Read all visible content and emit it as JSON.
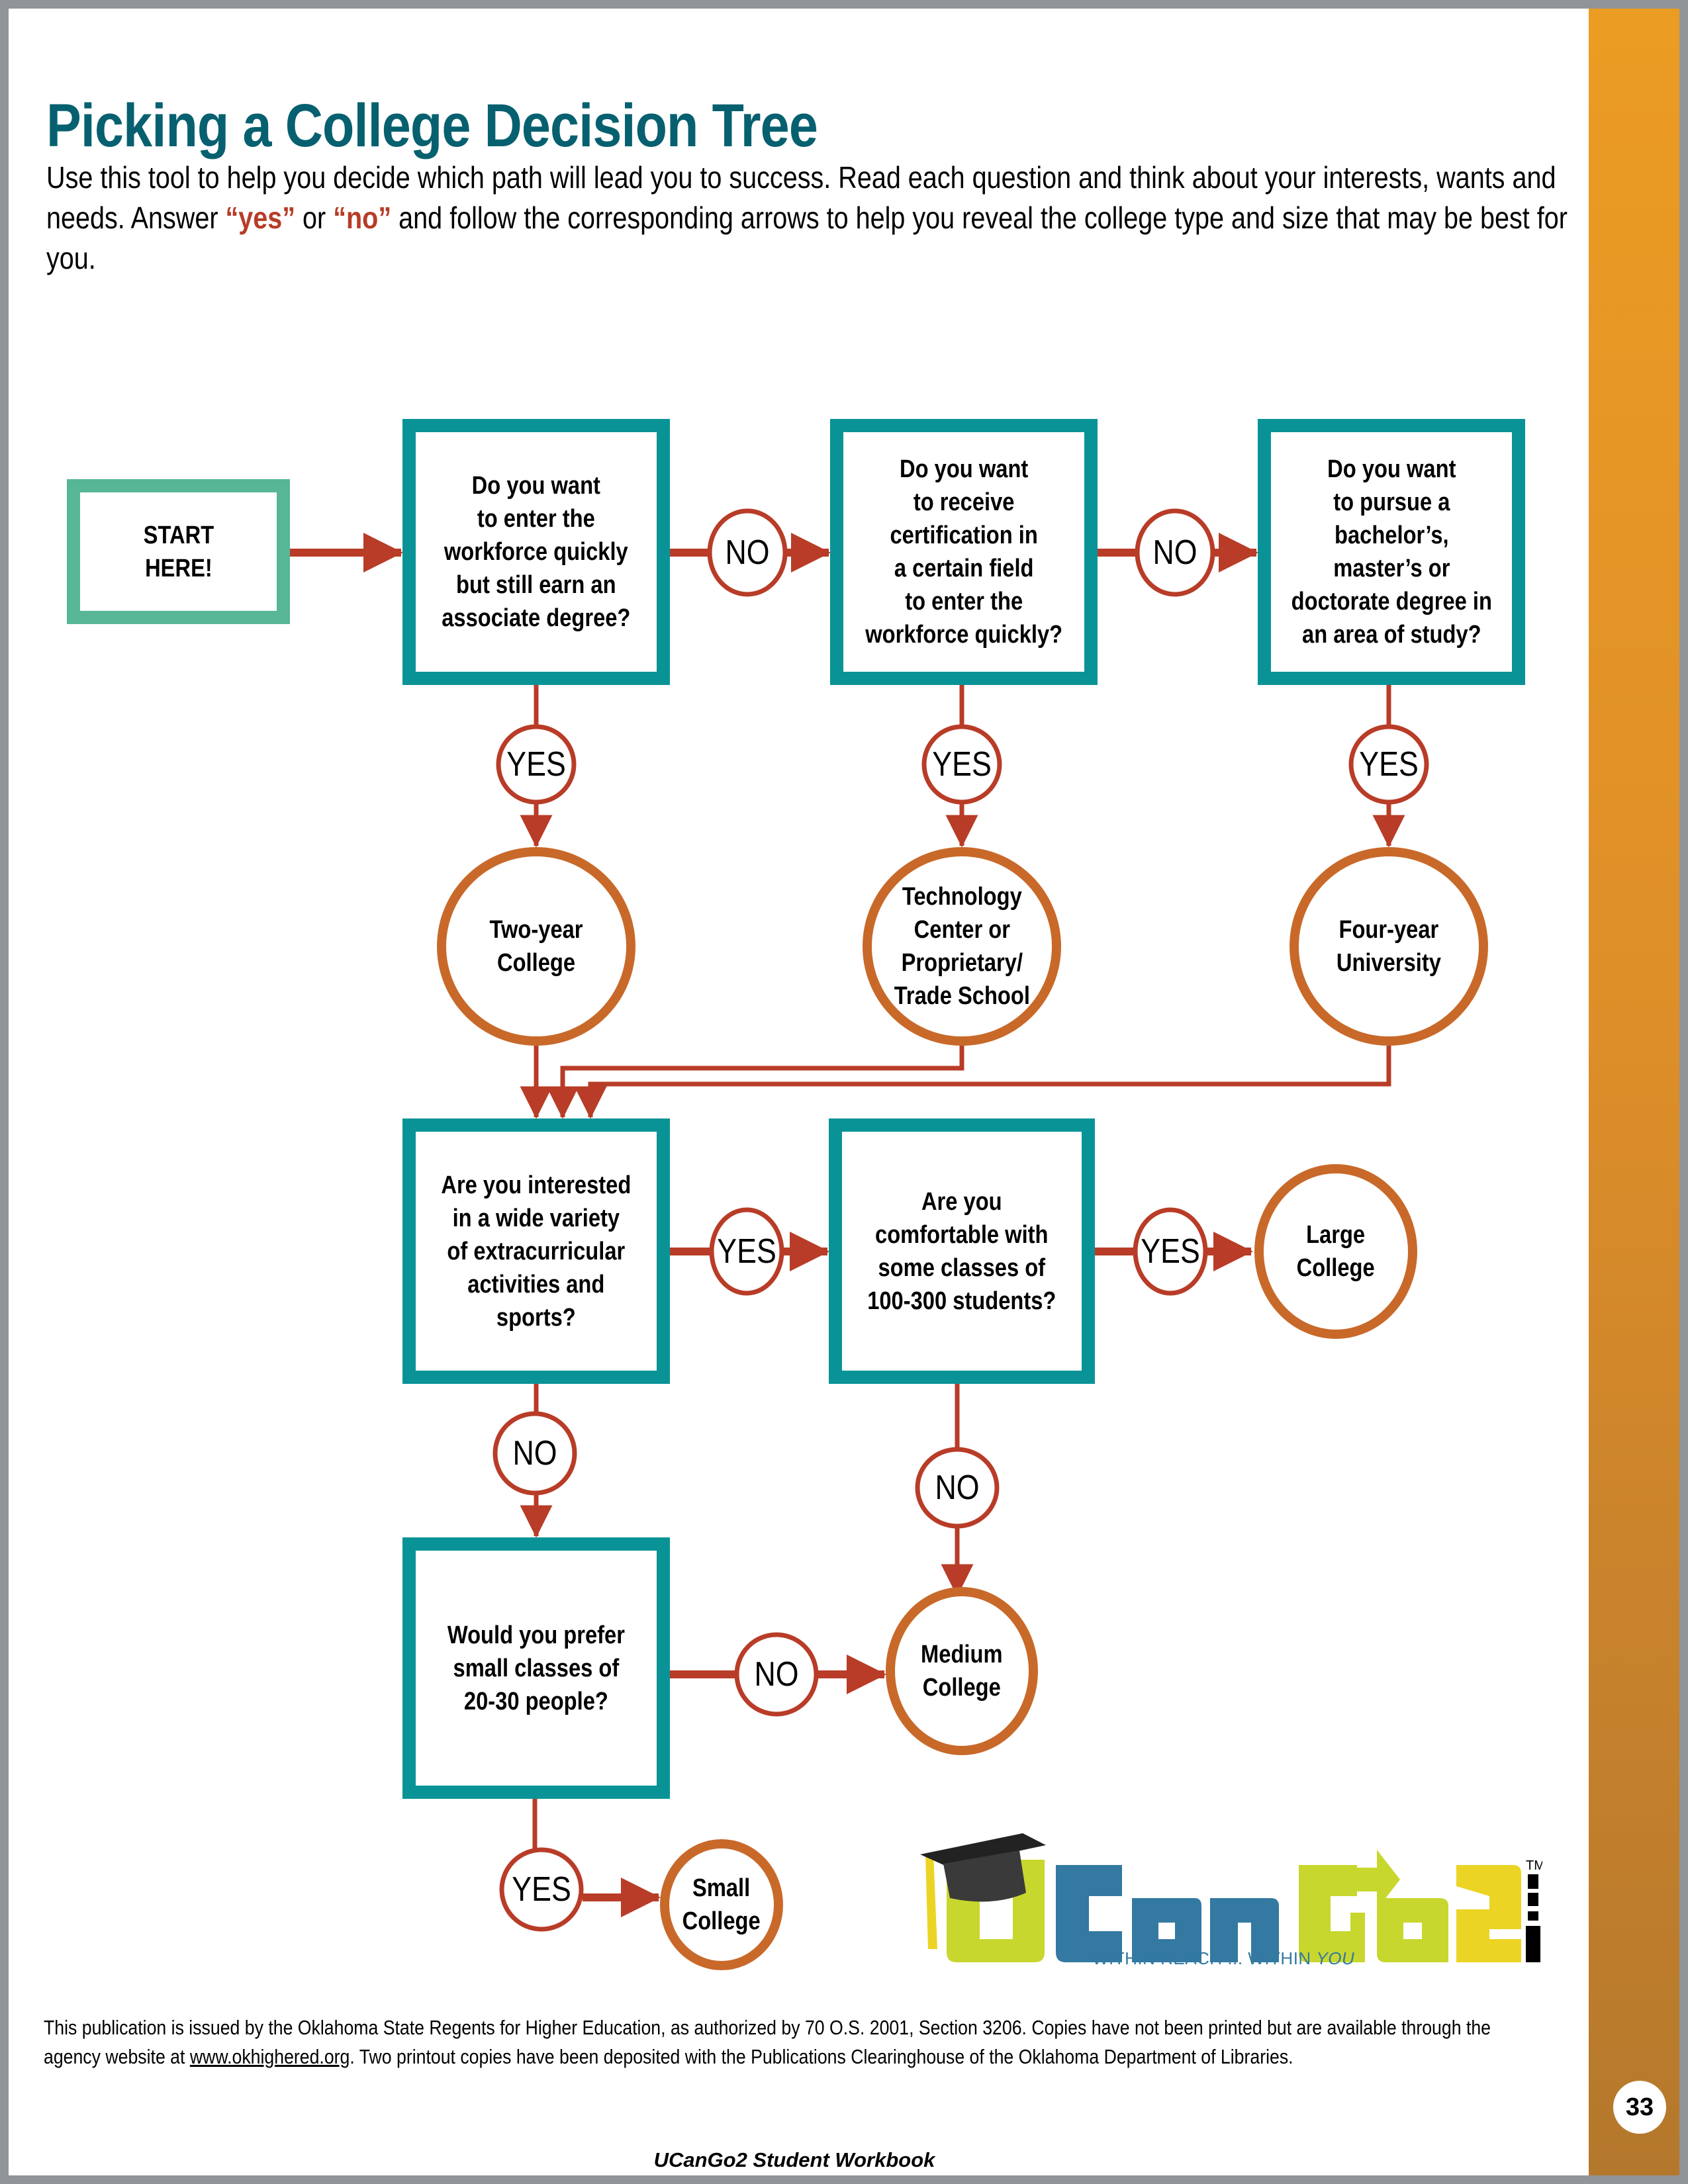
{
  "title": "Picking a College Decision Tree",
  "intro": {
    "before_yes": "Use this tool to help you decide which path will lead you to success. Read each question and think about your interests, wants and needs. Answer ",
    "yes_word": "“yes”",
    "between": " or ",
    "no_word": "“no”",
    "after_no": " and follow the corresponding arrows to help you reveal the college type and size that may be best for you."
  },
  "colors": {
    "teal_box": "#0a9396",
    "start_box": "#56b696",
    "arrow_red": "#b83c27",
    "outcome_orange": "#c8692a",
    "title_teal": "#07606f",
    "sidebar_orange": "#e79a24"
  },
  "flowchart": {
    "start": "START\nHERE!",
    "questions": {
      "q1": "Do you want\nto enter the\nworkforce quickly\nbut still earn an\nassociate degree?",
      "q2": "Do you want\nto receive\ncertification in\na certain field\nto enter the\nworkforce quickly?",
      "q3": "Do you want\nto pursue a\nbachelor’s,\nmaster’s or\ndoctorate degree in\nan area of study?",
      "q4": "Are you interested\nin a wide variety\nof extracurricular\nactivities and\nsports?",
      "q5": "Are you\ncomfortable with\nsome classes of\n100-300 students?",
      "q6": "Would you prefer\nsmall classes of\n20-30 people?"
    },
    "outcomes": {
      "two_year": "Two-year\nCollege",
      "tech_center": "Technology\nCenter or\nProprietary/\nTrade School",
      "four_year": "Four-year\nUniversity",
      "large": "Large\nCollege",
      "medium": "Medium\nCollege",
      "small": "Small\nCollege"
    },
    "answers": {
      "yes": "YES",
      "no": "NO"
    }
  },
  "logo": {
    "parts": [
      "U",
      "Can",
      "Go",
      "2"
    ],
    "suffix": ".org",
    "tm": "TM",
    "tagline_main": "WITHIN REACH ... WITHIN ",
    "tagline_em": "YOU"
  },
  "disclaimer": {
    "before_link": "This publication is issued by the Oklahoma State Regents for Higher Education, as authorized by 70 O.S. 2001, Section 3206. Copies have not been printed but are available through the agency website at ",
    "link": "www.okhighered.org",
    "after_link": ". Two printout copies have been deposited with the Publications Clearinghouse of the Oklahoma Department of Libraries."
  },
  "footer": "UCanGo2 Student Workbook",
  "page_number": "33"
}
